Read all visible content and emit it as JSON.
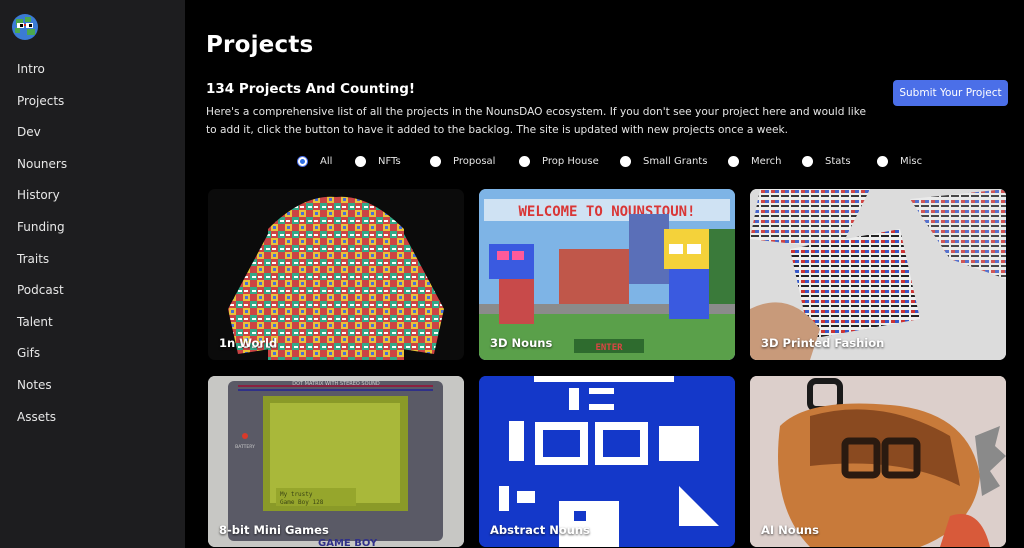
{
  "sidebar": {
    "logo_icon": "nouns-globe-logo",
    "items": [
      {
        "label": "Intro"
      },
      {
        "label": "Projects"
      },
      {
        "label": "Dev"
      },
      {
        "label": "Nouners"
      },
      {
        "label": "History"
      },
      {
        "label": "Funding"
      },
      {
        "label": "Traits"
      },
      {
        "label": "Podcast"
      },
      {
        "label": "Talent"
      },
      {
        "label": "Gifs"
      },
      {
        "label": "Notes"
      },
      {
        "label": "Assets"
      }
    ]
  },
  "main": {
    "title": "Projects",
    "subtitle": "134 Projects And Counting!",
    "description": "Here's a comprehensive list of all the projects in the NounsDAO ecosystem. If you don't see your project here and would like to add it, click the button to have it added to the backlog. The site is updated with new projects once a week.",
    "submit_label": "Submit Your Project",
    "accent_color": "#4b6fe8"
  },
  "filters": {
    "selected": "All",
    "options": [
      {
        "label": "All"
      },
      {
        "label": "NFTs"
      },
      {
        "label": "Proposal"
      },
      {
        "label": "Prop House"
      },
      {
        "label": "Small Grants"
      },
      {
        "label": "Merch"
      },
      {
        "label": "Stats"
      },
      {
        "label": "Misc"
      }
    ]
  },
  "projects": [
    {
      "name": "1n World"
    },
    {
      "name": "3D Nouns",
      "image_text_banner": "WELCOME TO NOUNSTOUN!",
      "image_text_button": "ENTER"
    },
    {
      "name": "3D Printed Fashion"
    },
    {
      "name": "8-bit Mini Games",
      "image_text_top": "DOT MATRIX WITH STEREO SOUND",
      "image_text_battery": "BATTERY",
      "image_text_brand": "GAME BOY",
      "image_text_screen_1": "My trusty",
      "image_text_screen_2": "Game Boy 128"
    },
    {
      "name": "Abstract Nouns"
    },
    {
      "name": "AI Nouns"
    }
  ]
}
